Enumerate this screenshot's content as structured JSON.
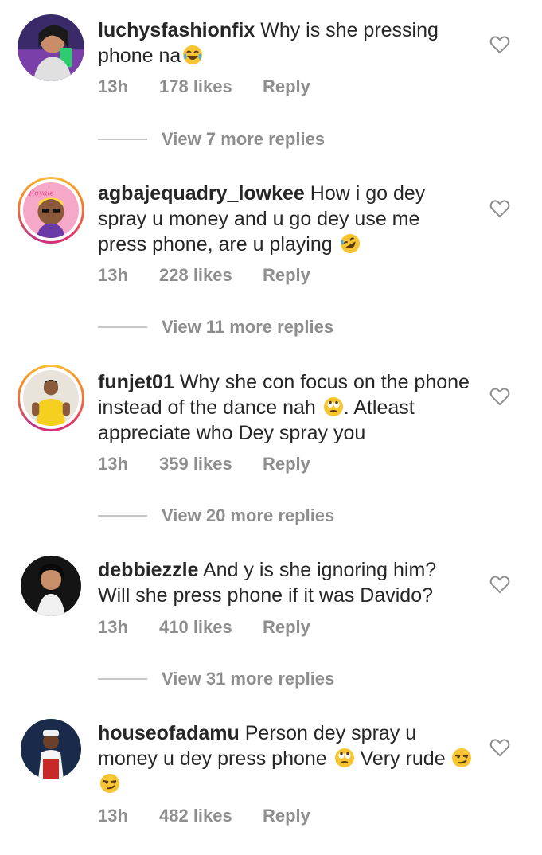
{
  "comments": [
    {
      "username": "luchysfashionfix",
      "text": "Why is she pressing phone na",
      "time": "13h",
      "likes": "178 likes",
      "reply": "Reply",
      "view_replies": "View 7 more replies",
      "avatar_icon": "profile-photo-woman",
      "emoji": [
        "face-with-tears-of-joy"
      ]
    },
    {
      "username": "agbajequadry_lowkee",
      "text": "How i go dey spray u money and u go dey use me press phone, are u playing",
      "time": "13h",
      "likes": "228 likes",
      "reply": "Reply",
      "view_replies": "View 11 more replies",
      "avatar_icon": "profile-photo-cartoon",
      "emoji": [
        "rolling-on-the-floor-laughing"
      ]
    },
    {
      "username": "funjet01",
      "text": "Why she con focus on the phone instead of the dance nah",
      "text_tail": ". Atleast appreciate who Dey spray you",
      "time": "13h",
      "likes": "359 likes",
      "reply": "Reply",
      "view_replies": "View 20 more replies",
      "avatar_icon": "profile-photo-woman-yellow",
      "emoji": [
        "face-with-rolling-eyes"
      ]
    },
    {
      "username": "debbiezzle",
      "text": "And y is she ignoring him? Will she press phone if it was Davido?",
      "time": "13h",
      "likes": "410 likes",
      "reply": "Reply",
      "view_replies": "View 31 more replies",
      "avatar_icon": "profile-photo-woman-dark"
    },
    {
      "username": "houseofadamu",
      "text": "Person dey spray u money u dey press phone",
      "text_tail": " Very rude",
      "time": "13h",
      "likes": "482 likes",
      "reply": "Reply",
      "avatar_icon": "profile-photo-man-hat",
      "emoji": [
        "face-with-rolling-eyes",
        "smirking-face",
        "smirking-face"
      ]
    }
  ],
  "icons": {
    "like": "heart-outline-icon"
  },
  "colors": {
    "text": "#262626",
    "secondary": "#8e8e8e",
    "story_ring": "#e1306c"
  }
}
